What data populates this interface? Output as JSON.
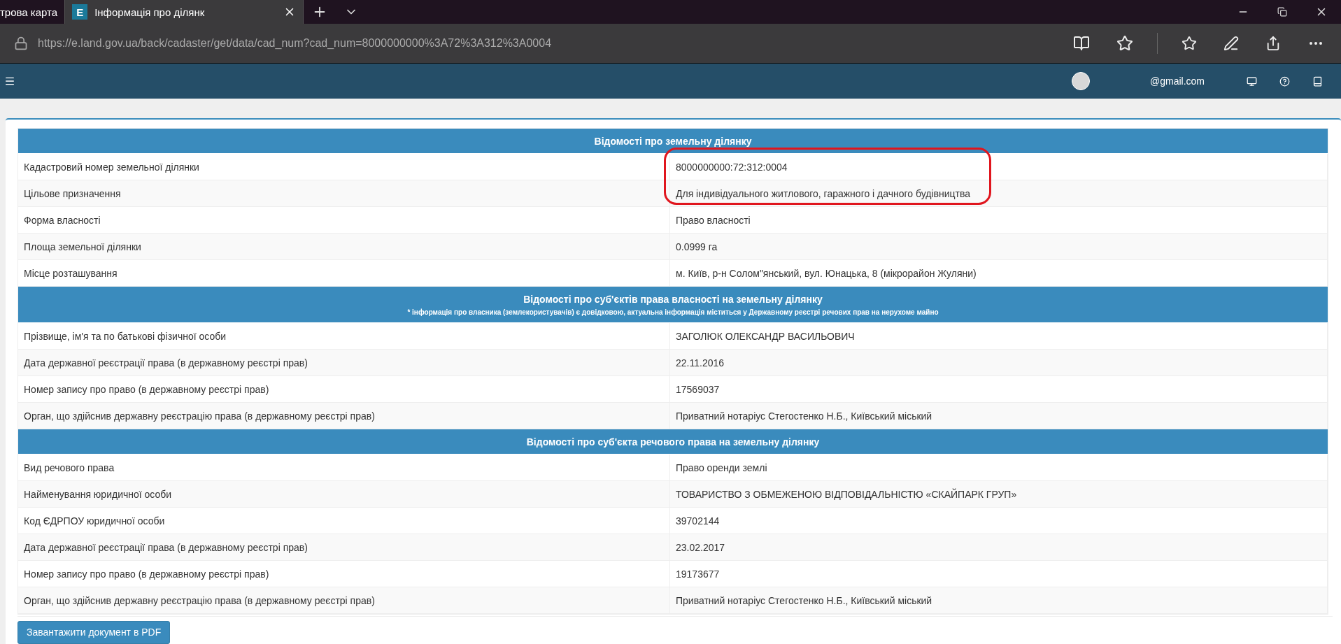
{
  "browser": {
    "tabs": [
      {
        "title": "трова карта",
        "selected": false
      },
      {
        "title": "Інформація про ділянк",
        "selected": true,
        "badge": "E"
      }
    ],
    "url": "https://e.land.gov.ua/back/cadaster/get/data/cad_num?cad_num=8000000000%3A72%3A312%3A0004"
  },
  "app_header": {
    "user_email": "@gmail.com"
  },
  "sections": [
    {
      "title": "Відомості про земельну ділянку",
      "rows": [
        {
          "label": "Кадастровий номер земельної ділянки",
          "value": "8000000000:72:312:0004",
          "circled": true
        },
        {
          "label": "Цільове призначення",
          "value": "Для індивідуального житлового, гаражного і дачного будівництва",
          "circled": true
        },
        {
          "label": "Форма власності",
          "value": "Право власності",
          "circled": false
        },
        {
          "label": "Площа земельної ділянки",
          "value": "0.0999 га",
          "circled": false
        },
        {
          "label": "Місце розташування",
          "value": "м. Київ, р-н Солом\"янський, вул. Юнацька, 8 (мікрорайон Жуляни)",
          "circled": false
        }
      ]
    },
    {
      "title": "Відомості про суб'єктів права власності на земельну ділянку",
      "note": "* інформація про власника (землекористувачів) є довідковою, актуальна інформація міститься у Державному реєстрі речових прав на нерухоме майно",
      "rows": [
        {
          "label": "Прізвище, ім'я та по батькові фізичної особи",
          "value": "ЗАГОЛЮК ОЛЕКСАНДР ВАСИЛЬОВИЧ",
          "circled": false
        },
        {
          "label": "Дата державної реєстрації права (в державному реєстрі прав)",
          "value": "22.11.2016",
          "circled": false
        },
        {
          "label": "Номер запису про право (в державному реєстрі прав)",
          "value": "17569037",
          "circled": false
        },
        {
          "label": "Орган, що здійснив державну реєстрацію права (в державному реєстрі прав)",
          "value": "Приватний нотаріус Стегостенко Н.Б., Київський міський",
          "circled": false
        }
      ]
    },
    {
      "title": "Відомості про суб'єкта речового права на земельну ділянку",
      "rows": [
        {
          "label": "Вид речового права",
          "value": "Право оренди землі",
          "circled": false
        },
        {
          "label": "Найменування юридичної особи",
          "value": "ТОВАРИСТВО З ОБМЕЖЕНОЮ ВІДПОВІДАЛЬНІСТЮ «СКАЙПАРК ГРУП»",
          "circled": false
        },
        {
          "label": "Код ЄДРПОУ юридичної особи",
          "value": "39702144",
          "circled": false
        },
        {
          "label": "Дата державної реєстрації права (в державному реєстрі прав)",
          "value": "23.02.2017",
          "circled": false
        },
        {
          "label": "Номер запису про право (в державному реєстрі прав)",
          "value": "19173677",
          "circled": false
        },
        {
          "label": "Орган, що здійснив державну реєстрацію права (в державному реєстрі прав)",
          "value": "Приватний нотаріус Стегостенко Н.Б., Київський міський",
          "circled": false
        }
      ]
    }
  ],
  "download_button": "Завантажити документ в PDF"
}
